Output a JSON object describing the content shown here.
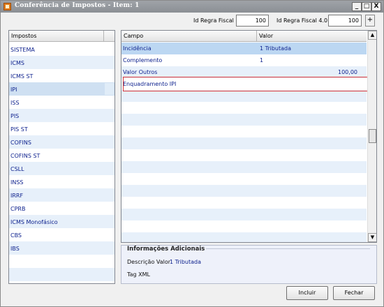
{
  "window": {
    "title": "Conferência de Impostos - Item: 1",
    "controls": {
      "minimize": "_",
      "maximize": "□",
      "close": "X"
    }
  },
  "top_fields": {
    "regra_fiscal_label": "Id Regra Fiscal",
    "regra_fiscal_value": "100",
    "regra_fiscal_40_label": "Id Regra Fiscal 4.0",
    "regra_fiscal_40_value": "100",
    "plus_label": "+"
  },
  "impostos": {
    "header": "Impostos",
    "items": [
      "SISTEMA",
      "ICMS",
      "ICMS ST",
      "IPI",
      "ISS",
      "PIS",
      "PIS ST",
      "COFINS",
      "COFINS ST",
      "CSLL",
      "INSS",
      "IRRF",
      "CPRB",
      "ICMS Monofásico",
      "CBS",
      "IBS"
    ],
    "selected": "IPI"
  },
  "grid": {
    "columns": [
      "Campo",
      "Valor"
    ],
    "rows": [
      {
        "campo": "Incidência",
        "valor": "1 Tributada"
      },
      {
        "campo": "Complemento",
        "valor": "1"
      },
      {
        "campo": "Valor Outros",
        "valor": "100,00"
      },
      {
        "campo": "Enquadramento IPI",
        "valor": ""
      }
    ],
    "scroll_up": "▲",
    "scroll_down": "▼"
  },
  "info": {
    "title": "Informações Adicionais",
    "descricao_label": "Descrição Valor",
    "descricao_value": "1 Tributada",
    "tag_label": "Tag XML",
    "tag_value": ""
  },
  "buttons": {
    "incluir": "Incluir",
    "fechar": "Fechar"
  }
}
